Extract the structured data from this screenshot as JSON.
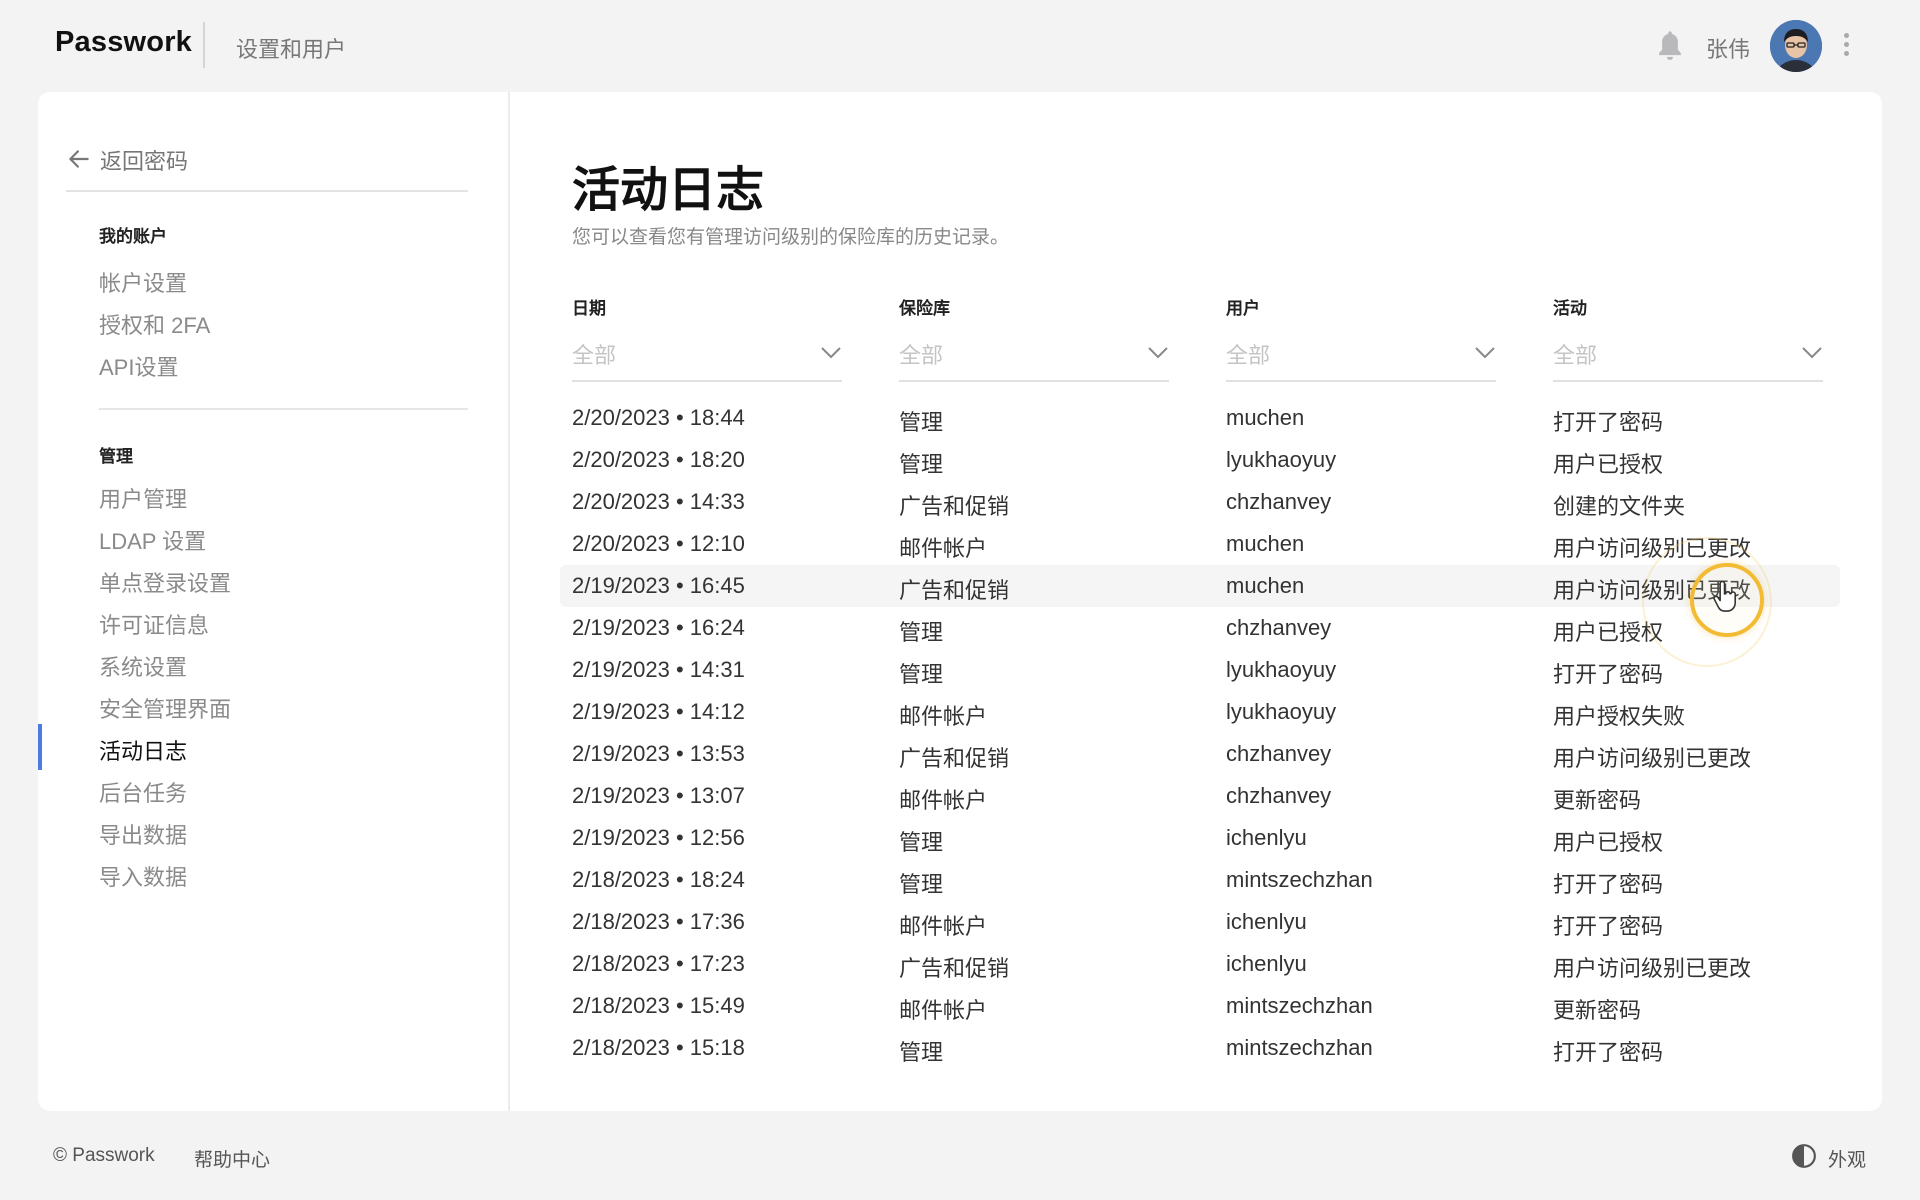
{
  "header": {
    "brand": "Passwork",
    "subtitle": "设置和用户",
    "user_name": "张伟",
    "icons": {
      "bell": "bell-icon",
      "menu": "kebab-menu-icon"
    }
  },
  "sidebar": {
    "back_label": "返回密码",
    "sections": [
      {
        "title": "我的账户",
        "items": [
          "帐户设置",
          "授权和 2FA",
          "API设置"
        ]
      },
      {
        "title": "管理",
        "items": [
          "用户管理",
          "LDAP 设置",
          "单点登录设置",
          "许可证信息",
          "系统设置",
          "安全管理界面",
          "活动日志",
          "后台任务",
          "导出数据",
          "导入数据"
        ]
      }
    ],
    "active_item": "活动日志"
  },
  "main": {
    "title": "活动日志",
    "description": "您可以查看您有管理访问级别的保险库的历史记录。",
    "columns": [
      {
        "label": "日期",
        "filter_value": "全部"
      },
      {
        "label": "保险库",
        "filter_value": "全部"
      },
      {
        "label": "用户",
        "filter_value": "全部"
      },
      {
        "label": "活动",
        "filter_value": "全部"
      }
    ],
    "rows": [
      {
        "date": "2/20/2023 • 18:44",
        "vault": "管理",
        "user": "muchen",
        "activity": "打开了密码"
      },
      {
        "date": "2/20/2023 • 18:20",
        "vault": "管理",
        "user": "lyukhaoyuy",
        "activity": "用户已授权"
      },
      {
        "date": "2/20/2023 • 14:33",
        "vault": "广告和促销",
        "user": "chzhanvey",
        "activity": "创建的文件夹"
      },
      {
        "date": "2/20/2023 • 12:10",
        "vault": "邮件帐户",
        "user": "muchen",
        "activity": "用户访问级别已更改"
      },
      {
        "date": "2/19/2023 • 16:45",
        "vault": "广告和促销",
        "user": "muchen",
        "activity": "用户访问级别已更改"
      },
      {
        "date": "2/19/2023 • 16:24",
        "vault": "管理",
        "user": "chzhanvey",
        "activity": "用户已授权"
      },
      {
        "date": "2/19/2023 • 14:31",
        "vault": "管理",
        "user": "lyukhaoyuy",
        "activity": "打开了密码"
      },
      {
        "date": "2/19/2023 • 14:12",
        "vault": "邮件帐户",
        "user": "lyukhaoyuy",
        "activity": "用户授权失败"
      },
      {
        "date": "2/19/2023 • 13:53",
        "vault": "广告和促销",
        "user": "chzhanvey",
        "activity": "用户访问级别已更改"
      },
      {
        "date": "2/19/2023 • 13:07",
        "vault": "邮件帐户",
        "user": "chzhanvey",
        "activity": "更新密码"
      },
      {
        "date": "2/19/2023 • 12:56",
        "vault": "管理",
        "user": "ichenlyu",
        "activity": "用户已授权"
      },
      {
        "date": "2/18/2023 • 18:24",
        "vault": "管理",
        "user": "mintszechzhan",
        "activity": "打开了密码"
      },
      {
        "date": "2/18/2023 • 17:36",
        "vault": "邮件帐户",
        "user": "ichenlyu",
        "activity": "打开了密码"
      },
      {
        "date": "2/18/2023 • 17:23",
        "vault": "广告和促销",
        "user": "ichenlyu",
        "activity": "用户访问级别已更改"
      },
      {
        "date": "2/18/2023 • 15:49",
        "vault": "邮件帐户",
        "user": "mintszechzhan",
        "activity": "更新密码"
      },
      {
        "date": "2/18/2023 • 15:18",
        "vault": "管理",
        "user": "mintszechzhan",
        "activity": "打开了密码"
      }
    ],
    "highlighted_row": 4
  },
  "footer": {
    "copyright": "© Passwork",
    "help": "帮助中心",
    "theme_label": "外观"
  },
  "colors": {
    "accent": "#4a7be0",
    "cursor_ring": "#f3bb34"
  }
}
